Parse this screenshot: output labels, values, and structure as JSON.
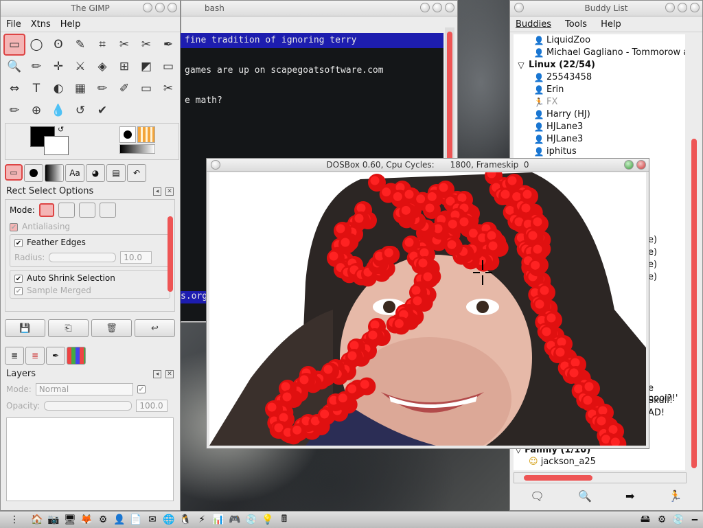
{
  "gimp": {
    "title": "The GIMP",
    "menu": [
      "File",
      "Xtns",
      "Help"
    ],
    "tools": [
      "▭",
      "◯",
      "ʘ",
      "✎",
      "⌗",
      "✂",
      "✂",
      "✒",
      "🔍",
      "✏",
      "✛",
      "⚔",
      "◈",
      "⊞",
      "◩",
      "▭",
      "⇔",
      "T",
      "◐",
      "▦",
      "✏",
      "✐",
      "▭",
      "✂",
      "✏",
      "⊕",
      "💧",
      "↺",
      "✔"
    ],
    "rect_select": {
      "header": "Rect Select Options",
      "mode_label": "Mode:",
      "antialiasing": "Antialiasing",
      "feather_edges": "Feather Edges",
      "radius_label": "Radius:",
      "radius_value": "10.0",
      "auto_shrink": "Auto Shrink Selection",
      "sample_merged": "Sample Merged"
    },
    "layers": {
      "header": "Layers",
      "mode_label": "Mode:",
      "mode_value": "Normal",
      "opacity_label": "Opacity:",
      "opacity_value": "100.0"
    }
  },
  "bash": {
    "title": "bash",
    "lines": [
      {
        "text": "fine tradition of ignoring terry",
        "highlight": true
      },
      {
        "text": "",
        "highlight": false
      },
      {
        "text": "games are up on scapegoatsoftware.com",
        "highlight": false
      },
      {
        "text": "",
        "highlight": false
      },
      {
        "text": "e math?",
        "highlight": false
      }
    ],
    "fragment": "s.org"
  },
  "buddy": {
    "title": "Buddy List",
    "menu": [
      "Buddies",
      "Tools",
      "Help"
    ],
    "items": [
      {
        "label": "LiquidZoo",
        "kind": "person",
        "color": "#3a8ad8"
      },
      {
        "label": "Michael Gagliano - Tommorow at",
        "kind": "person",
        "color": "#3a8ad8"
      },
      {
        "label": "Linux (22/54)",
        "kind": "group",
        "color": "#000000"
      },
      {
        "label": "25543458",
        "kind": "person",
        "color": "#29a329"
      },
      {
        "label": "Erin",
        "kind": "person",
        "color": "#29a329"
      },
      {
        "label": "FX",
        "kind": "away",
        "color": "#d4a017"
      },
      {
        "label": "Harry (HJ)",
        "kind": "person",
        "color": "#3a8ad8"
      },
      {
        "label": "HJLane3",
        "kind": "person",
        "color": "#d4a017"
      },
      {
        "label": "HJLane3",
        "kind": "person",
        "color": "#d4a017"
      },
      {
        "label": "iphitus",
        "kind": "person",
        "color": "#d4a017"
      }
    ],
    "right_fragments": [
      "e)",
      "e)",
      "e)",
      "e)"
    ],
    "chat_fragments": [
      "e pool?!'",
      "Skull!",
      "AD!"
    ],
    "family_group": "Family (1/10)",
    "family_item": "jackson_a25"
  },
  "dosbox": {
    "title": "DOSBox 0.60, Cpu Cycles:      1800, Frameskip  0"
  },
  "taskbar": {
    "icons": [
      "🏠",
      "📷",
      "🖥",
      "🦊",
      "⚙",
      "👤",
      "📄",
      "✉",
      "🌐",
      "🐧",
      "⚡",
      "📊",
      "🎮",
      "💿",
      "💡",
      "🖩"
    ],
    "right_icons": [
      "🖴",
      "⚙",
      "💿",
      "🗕"
    ]
  }
}
